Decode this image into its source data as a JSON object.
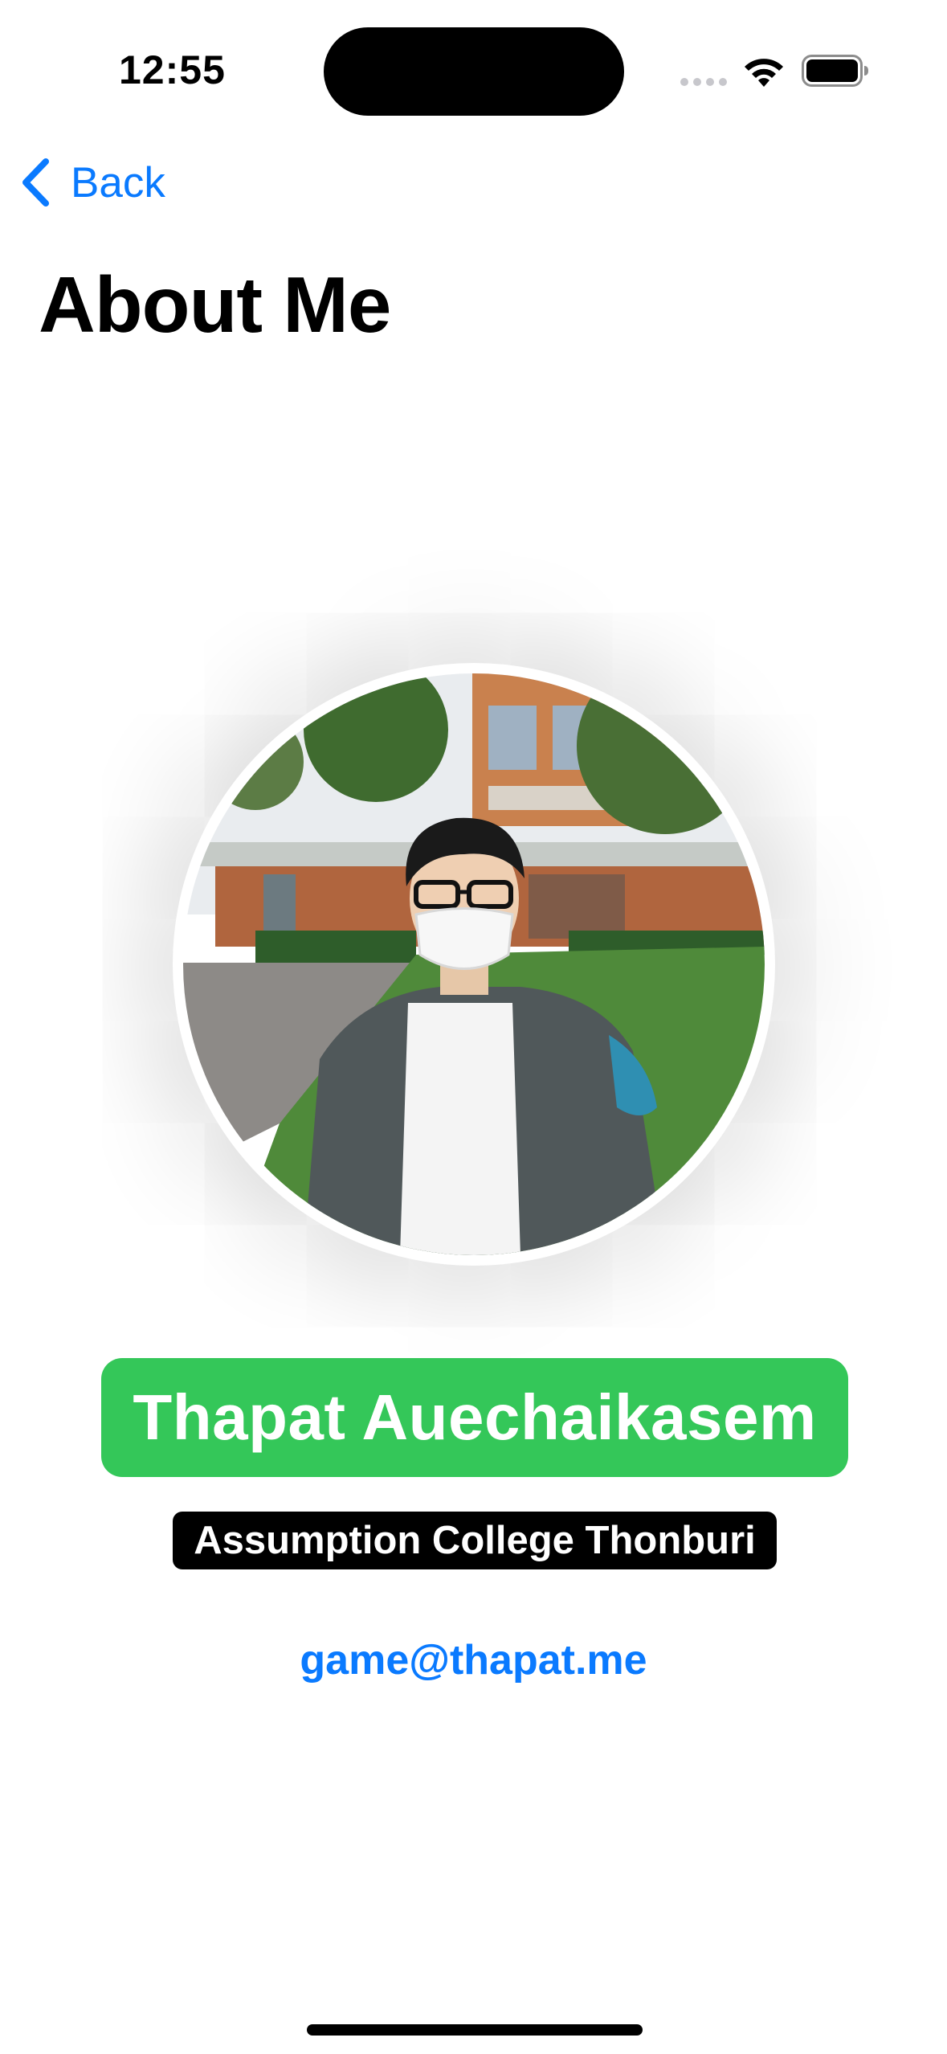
{
  "status_bar": {
    "time": "12:55",
    "icons": [
      "cellular-signal-icon",
      "wifi-icon",
      "battery-icon"
    ]
  },
  "nav": {
    "back_label": "Back",
    "title": "About Me"
  },
  "profile": {
    "photo": "profile-photo",
    "name": "Thapat Auechaikasem",
    "school": "Assumption College Thonburi",
    "email": "game@thapat.me"
  },
  "colors": {
    "accent": "#0a7aff",
    "name_badge": "#34c759",
    "school_badge": "#000000",
    "background": "#ffffff"
  }
}
